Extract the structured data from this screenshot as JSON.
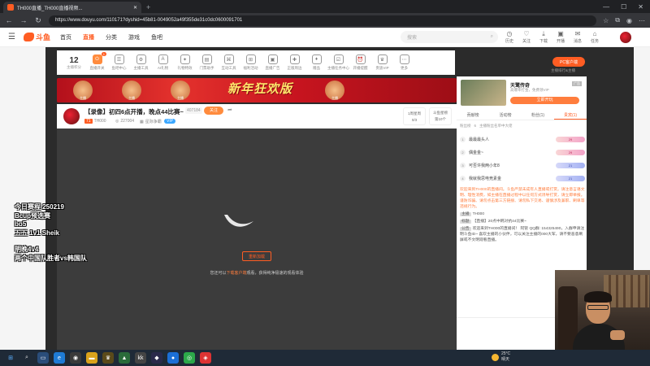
{
  "browser": {
    "tab_title": "TH000直播_TH000直播视频...",
    "url": "https://www.douyu.com/110171?dyshid=45b81-0049052a49f355de31c0dc0600091701"
  },
  "header": {
    "logo_text": "斗鱼",
    "nav": [
      "首页",
      "直播",
      "分类",
      "游戏",
      "鱼吧"
    ],
    "search_placeholder": "搜索",
    "icons": [
      "历史",
      "关注",
      "下载",
      "开播",
      "消息",
      "任务"
    ]
  },
  "toolbar": {
    "level_number": "12",
    "level_label": "主播积分",
    "tools": [
      {
        "label": "直播开关",
        "badge": "1"
      },
      {
        "label": "鱼吧中心",
        "badge": ""
      },
      {
        "label": "主播工具",
        "badge": ""
      },
      {
        "label": "AI礼物",
        "badge": ""
      },
      {
        "label": "礼物特效",
        "badge": ""
      },
      {
        "label": "门票助手",
        "badge": ""
      },
      {
        "label": "互动工具",
        "badge": ""
      },
      {
        "label": "福利活动",
        "badge": ""
      },
      {
        "label": "直播广告",
        "badge": ""
      },
      {
        "label": "正版周边",
        "badge": ""
      },
      {
        "label": "赠品",
        "badge": ""
      },
      {
        "label": "主播任务中心",
        "badge": ""
      },
      {
        "label": "开播提醒",
        "badge": ""
      },
      {
        "label": "贵族VIP",
        "badge": ""
      },
      {
        "label": "更多",
        "badge": ""
      }
    ],
    "pc_client": "PC客户端",
    "pc_sub": "主播排行&主播"
  },
  "banner": {
    "title": "新年狂欢版",
    "figures": [
      "主播",
      "主播",
      "主播",
      "主播"
    ]
  },
  "room": {
    "title": "【录像】初四6点开播，晚点44比赛~",
    "hot": "407184",
    "follow": "关注",
    "meta_id": "TH000",
    "meta_fans": "227004",
    "meta_cat": "星际争霸",
    "rank_label": "1周星周",
    "rank_value": "0/3",
    "rank2_label": "斗鱼星榜",
    "rank2_value": "第10个"
  },
  "video": {
    "retry": "重新加载",
    "hint_prefix": "您还可以",
    "hint_link": "下载客户端",
    "hint_suffix": "观看，获得纯净极速的观看体验"
  },
  "overlay": {
    "lines": [
      "今日赛程 250219",
      "Bcup预选赛",
      "bo5",
      "五五 1v1 Sheik",
      "",
      "明晚4v4",
      "两个中国队胜者vs韩国队"
    ]
  },
  "ad": {
    "title": "天鹭传奇",
    "sub": "高爆率打金，免费领VIP",
    "button": "立即开玩",
    "tag": "广告"
  },
  "right_tabs": [
    "贡献榜",
    "活动榜",
    "粉丝(1)",
    "贵宾(1)"
  ],
  "fan_row": [
    "粉丝榜",
    "6",
    "主播粉丝名单中大佬"
  ],
  "rank_list": [
    {
      "no": "1",
      "name": "最最最头人",
      "pill": "29"
    },
    {
      "no": "2",
      "name": "偶金金~",
      "pill": "29"
    },
    {
      "no": "3",
      "name": "可否许我两小年8",
      "pill": "21"
    },
    {
      "no": "4",
      "name": "我就我思电竞素金",
      "pill": "21"
    }
  ],
  "chat": {
    "warning": "欢迎来到TH000的直播间。斗鱼严禁未成年人直播或打赏。请注意言语文明、理性消费，如主播在直播过程中以任何方式诱导打赏，请立即举报。谨防诈骗、请勿点击第三方链接、请勿私下交易、谨慎涉及兼职、刷单等违规行为。",
    "lines": [
      {
        "tag": "主播",
        "text": "TH000"
      },
      {
        "tag": "标题",
        "text": "【直播】20点中韩对抗44比赛~"
      },
      {
        "tag": "公告",
        "text": "欢迎来到TH000的直播间！ 阿管 QQ群: 154325490，入群申请注明斗鱼ID~ 喜欢主播的小伙伴，可以关注主播的000大军，请不要恶意刷屏或不文明观看直播。"
      }
    ]
  },
  "taskbar": {
    "weather_temp": "25°C",
    "weather_desc": "晴天"
  }
}
